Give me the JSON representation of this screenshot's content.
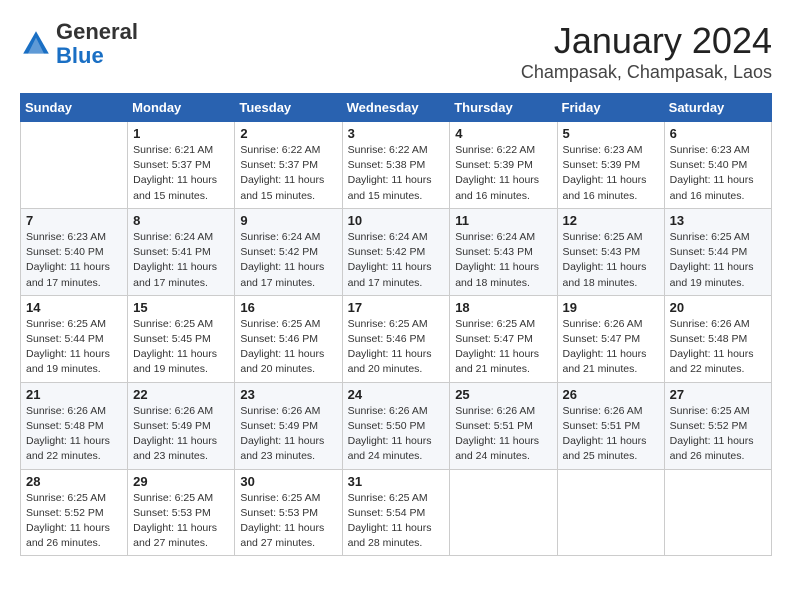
{
  "header": {
    "logo": {
      "general": "General",
      "blue": "Blue"
    },
    "title": "January 2024",
    "location": "Champasak, Champasak, Laos"
  },
  "weekdays": [
    "Sunday",
    "Monday",
    "Tuesday",
    "Wednesday",
    "Thursday",
    "Friday",
    "Saturday"
  ],
  "weeks": [
    [
      {
        "day": "",
        "info": ""
      },
      {
        "day": "1",
        "info": "Sunrise: 6:21 AM\nSunset: 5:37 PM\nDaylight: 11 hours\nand 15 minutes."
      },
      {
        "day": "2",
        "info": "Sunrise: 6:22 AM\nSunset: 5:37 PM\nDaylight: 11 hours\nand 15 minutes."
      },
      {
        "day": "3",
        "info": "Sunrise: 6:22 AM\nSunset: 5:38 PM\nDaylight: 11 hours\nand 15 minutes."
      },
      {
        "day": "4",
        "info": "Sunrise: 6:22 AM\nSunset: 5:39 PM\nDaylight: 11 hours\nand 16 minutes."
      },
      {
        "day": "5",
        "info": "Sunrise: 6:23 AM\nSunset: 5:39 PM\nDaylight: 11 hours\nand 16 minutes."
      },
      {
        "day": "6",
        "info": "Sunrise: 6:23 AM\nSunset: 5:40 PM\nDaylight: 11 hours\nand 16 minutes."
      }
    ],
    [
      {
        "day": "7",
        "info": "Sunrise: 6:23 AM\nSunset: 5:40 PM\nDaylight: 11 hours\nand 17 minutes."
      },
      {
        "day": "8",
        "info": "Sunrise: 6:24 AM\nSunset: 5:41 PM\nDaylight: 11 hours\nand 17 minutes."
      },
      {
        "day": "9",
        "info": "Sunrise: 6:24 AM\nSunset: 5:42 PM\nDaylight: 11 hours\nand 17 minutes."
      },
      {
        "day": "10",
        "info": "Sunrise: 6:24 AM\nSunset: 5:42 PM\nDaylight: 11 hours\nand 17 minutes."
      },
      {
        "day": "11",
        "info": "Sunrise: 6:24 AM\nSunset: 5:43 PM\nDaylight: 11 hours\nand 18 minutes."
      },
      {
        "day": "12",
        "info": "Sunrise: 6:25 AM\nSunset: 5:43 PM\nDaylight: 11 hours\nand 18 minutes."
      },
      {
        "day": "13",
        "info": "Sunrise: 6:25 AM\nSunset: 5:44 PM\nDaylight: 11 hours\nand 19 minutes."
      }
    ],
    [
      {
        "day": "14",
        "info": "Sunrise: 6:25 AM\nSunset: 5:44 PM\nDaylight: 11 hours\nand 19 minutes."
      },
      {
        "day": "15",
        "info": "Sunrise: 6:25 AM\nSunset: 5:45 PM\nDaylight: 11 hours\nand 19 minutes."
      },
      {
        "day": "16",
        "info": "Sunrise: 6:25 AM\nSunset: 5:46 PM\nDaylight: 11 hours\nand 20 minutes."
      },
      {
        "day": "17",
        "info": "Sunrise: 6:25 AM\nSunset: 5:46 PM\nDaylight: 11 hours\nand 20 minutes."
      },
      {
        "day": "18",
        "info": "Sunrise: 6:25 AM\nSunset: 5:47 PM\nDaylight: 11 hours\nand 21 minutes."
      },
      {
        "day": "19",
        "info": "Sunrise: 6:26 AM\nSunset: 5:47 PM\nDaylight: 11 hours\nand 21 minutes."
      },
      {
        "day": "20",
        "info": "Sunrise: 6:26 AM\nSunset: 5:48 PM\nDaylight: 11 hours\nand 22 minutes."
      }
    ],
    [
      {
        "day": "21",
        "info": "Sunrise: 6:26 AM\nSunset: 5:48 PM\nDaylight: 11 hours\nand 22 minutes."
      },
      {
        "day": "22",
        "info": "Sunrise: 6:26 AM\nSunset: 5:49 PM\nDaylight: 11 hours\nand 23 minutes."
      },
      {
        "day": "23",
        "info": "Sunrise: 6:26 AM\nSunset: 5:49 PM\nDaylight: 11 hours\nand 23 minutes."
      },
      {
        "day": "24",
        "info": "Sunrise: 6:26 AM\nSunset: 5:50 PM\nDaylight: 11 hours\nand 24 minutes."
      },
      {
        "day": "25",
        "info": "Sunrise: 6:26 AM\nSunset: 5:51 PM\nDaylight: 11 hours\nand 24 minutes."
      },
      {
        "day": "26",
        "info": "Sunrise: 6:26 AM\nSunset: 5:51 PM\nDaylight: 11 hours\nand 25 minutes."
      },
      {
        "day": "27",
        "info": "Sunrise: 6:25 AM\nSunset: 5:52 PM\nDaylight: 11 hours\nand 26 minutes."
      }
    ],
    [
      {
        "day": "28",
        "info": "Sunrise: 6:25 AM\nSunset: 5:52 PM\nDaylight: 11 hours\nand 26 minutes."
      },
      {
        "day": "29",
        "info": "Sunrise: 6:25 AM\nSunset: 5:53 PM\nDaylight: 11 hours\nand 27 minutes."
      },
      {
        "day": "30",
        "info": "Sunrise: 6:25 AM\nSunset: 5:53 PM\nDaylight: 11 hours\nand 27 minutes."
      },
      {
        "day": "31",
        "info": "Sunrise: 6:25 AM\nSunset: 5:54 PM\nDaylight: 11 hours\nand 28 minutes."
      },
      {
        "day": "",
        "info": ""
      },
      {
        "day": "",
        "info": ""
      },
      {
        "day": "",
        "info": ""
      }
    ]
  ]
}
